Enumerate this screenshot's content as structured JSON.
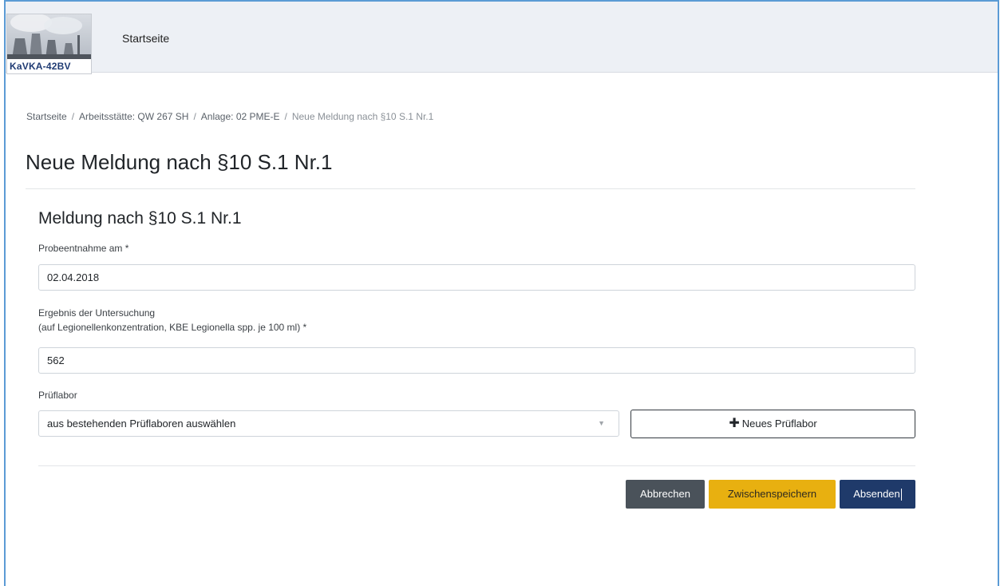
{
  "header": {
    "logo_text": "KaVKA-42BV",
    "nav_home": "Startseite"
  },
  "breadcrumb": {
    "items": [
      "Startseite",
      "Arbeitsstätte: QW 267 SH",
      "Anlage: 02 PME-E"
    ],
    "active": "Neue Meldung nach §10 S.1 Nr.1",
    "separator": "/"
  },
  "page": {
    "title": "Neue Meldung nach §10 S.1 Nr.1"
  },
  "form": {
    "section_title": "Meldung nach §10 S.1 Nr.1",
    "sample_date_label": "Probeentnahme am *",
    "sample_date_value": "02.04.2018",
    "result_label_line1": "Ergebnis der Untersuchung",
    "result_label_line2": "(auf Legionellenkonzentration, KBE Legionella spp. je 100 ml) *",
    "result_value": "562",
    "lab_label": "Prüflabor",
    "lab_select_value": "aus bestehenden Prüflaboren auswählen",
    "new_lab_button": "Neues Prüflabor"
  },
  "actions": {
    "cancel": "Abbrechen",
    "save_draft": "Zwischenspeichern",
    "submit": "Absenden"
  },
  "colors": {
    "cancel_bg": "#4a525a",
    "save_bg": "#e8b010",
    "submit_bg": "#1f3a6a",
    "window_border": "#5b9bd5"
  },
  "icons": {
    "plus": "plus-icon",
    "select_caret": "caret-down-icon",
    "logo": "power-plant-cooling-towers"
  }
}
